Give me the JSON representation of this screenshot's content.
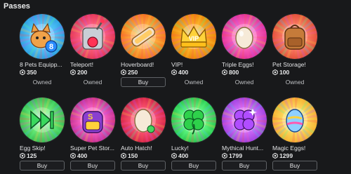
{
  "section_title": "Passes",
  "status_text": "Owned",
  "buy_label": "Buy",
  "passes": [
    {
      "name": "8 Pets Equipp...",
      "price": "350",
      "owned": true,
      "icon": "pet-icon",
      "bg": [
        "#5fd0ff",
        "#1e8fd6"
      ]
    },
    {
      "name": "Teleport!",
      "price": "200",
      "owned": true,
      "icon": "teleport-icon",
      "bg": [
        "#ff6b8a",
        "#d9254e"
      ]
    },
    {
      "name": "Hoverboard!",
      "price": "250",
      "owned": false,
      "icon": "hoverboard-icon",
      "bg": [
        "#ffb24a",
        "#f06a10"
      ]
    },
    {
      "name": "VIP!",
      "price": "400",
      "owned": true,
      "icon": "crown-icon",
      "bg": [
        "#ffb52e",
        "#e57b00"
      ]
    },
    {
      "name": "Triple Eggs!",
      "price": "800",
      "owned": true,
      "icon": "eggs-icon",
      "bg": [
        "#ff6fc3",
        "#d5208c"
      ]
    },
    {
      "name": "Pet Storage!",
      "price": "100",
      "owned": true,
      "icon": "backpack-icon",
      "bg": [
        "#ff8a6e",
        "#d7412a"
      ]
    },
    {
      "name": "Egg Skip!",
      "price": "125",
      "owned": false,
      "icon": "skip-icon",
      "bg": [
        "#7cf07a",
        "#22b04a"
      ]
    },
    {
      "name": "Super Pet Stor...",
      "price": "400",
      "owned": false,
      "icon": "super-backpack-icon",
      "bg": [
        "#ff6bd0",
        "#b0207e"
      ]
    },
    {
      "name": "Auto Hatch!",
      "price": "150",
      "owned": false,
      "icon": "egg-icon",
      "bg": [
        "#ff5a7a",
        "#c8173c"
      ]
    },
    {
      "name": "Lucky!",
      "price": "400",
      "owned": false,
      "icon": "clover-icon",
      "bg": [
        "#6dff8a",
        "#17b83e"
      ]
    },
    {
      "name": "Mythical Hunt...",
      "price": "1799",
      "owned": false,
      "icon": "mythical-clover-icon",
      "bg": [
        "#e07bff",
        "#8a2fd0"
      ]
    },
    {
      "name": "Magic Eggs!",
      "price": "1299",
      "owned": false,
      "icon": "magic-egg-icon",
      "bg": [
        "#ffe36a",
        "#f0a020"
      ]
    }
  ]
}
